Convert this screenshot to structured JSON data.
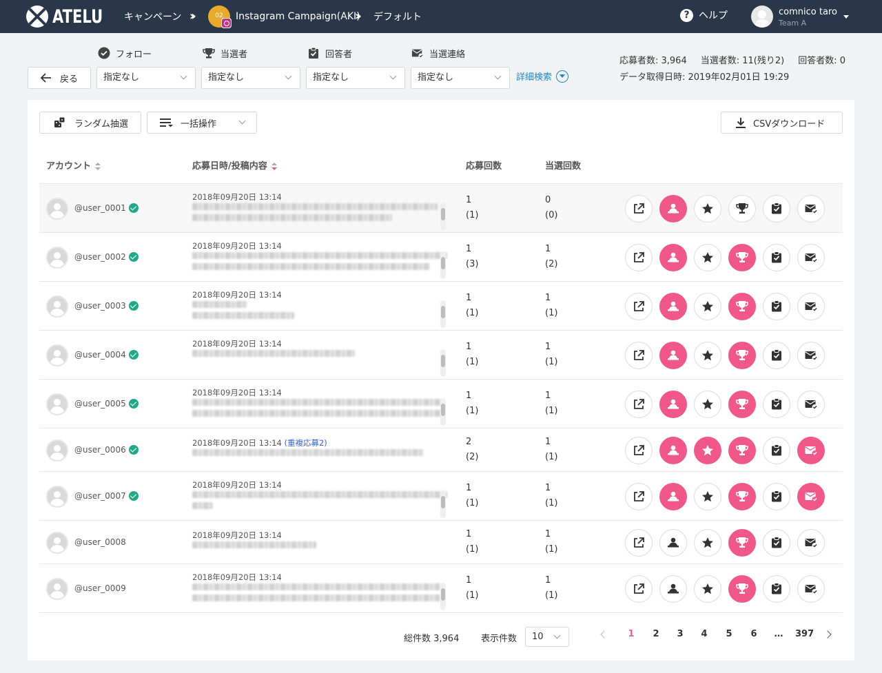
{
  "header": {
    "logo_text": "ATELU",
    "breadcrumb_campaigns": "キャンペーン",
    "campaign_badge": "02",
    "campaign_name": "Instagram Campaign(AKI)",
    "breadcrumb_default": "デフォルト",
    "help_label": "ヘルプ",
    "user_name": "comnico taro",
    "user_team": "Team A"
  },
  "toolbar": {
    "back_label": "戻る",
    "filters": [
      {
        "label": "フォロー",
        "value": "指定なし",
        "icon": "check-circle-icon"
      },
      {
        "label": "当選者",
        "value": "指定なし",
        "icon": "trophy-icon"
      },
      {
        "label": "回答者",
        "value": "指定なし",
        "icon": "clipboard-check-icon"
      },
      {
        "label": "当選連絡",
        "value": "指定なし",
        "icon": "mail-check-icon"
      }
    ],
    "advanced_search": "詳細検索"
  },
  "stats": {
    "applicants": "応募者数: 3,964",
    "winners": "当選者数: 11(残り2)",
    "respondents": "回答者数: 0",
    "fetched_at": "データ取得日時: 2019年02月01日 19:29"
  },
  "actions": {
    "random_draw": "ランダム抽選",
    "bulk_ops": "一括操作",
    "csv_download": "CSVダウンロード"
  },
  "table": {
    "headers": {
      "account": "アカウント",
      "post": "応募日時/投稿内容",
      "apply_count": "応募回数",
      "win_count": "当選回数"
    },
    "rows": [
      {
        "user": "@user_0001",
        "verified": true,
        "date": "2018年09月20日 13:14",
        "dup": "",
        "apply": "1",
        "apply_total": "(1)",
        "win": "0",
        "win_total": "(0)",
        "state": {
          "entry": true,
          "star": false,
          "winner": false,
          "answer": false,
          "notified": false
        }
      },
      {
        "user": "@user_0002",
        "verified": true,
        "date": "2018年09月20日 13:14",
        "dup": "",
        "apply": "1",
        "apply_total": "(3)",
        "win": "1",
        "win_total": "(2)",
        "state": {
          "entry": true,
          "star": false,
          "winner": true,
          "answer": false,
          "notified": false
        }
      },
      {
        "user": "@user_0003",
        "verified": true,
        "date": "2018年09月20日 13:14",
        "dup": "",
        "apply": "1",
        "apply_total": "(1)",
        "win": "1",
        "win_total": "(1)",
        "state": {
          "entry": true,
          "star": false,
          "winner": true,
          "answer": false,
          "notified": false
        }
      },
      {
        "user": "@user_0004",
        "verified": true,
        "date": "2018年09月20日 13:14",
        "dup": "",
        "apply": "1",
        "apply_total": "(1)",
        "win": "1",
        "win_total": "(1)",
        "state": {
          "entry": true,
          "star": false,
          "winner": true,
          "answer": false,
          "notified": false
        }
      },
      {
        "user": "@user_0005",
        "verified": true,
        "date": "2018年09月20日 13:14",
        "dup": "",
        "apply": "1",
        "apply_total": "(1)",
        "win": "1",
        "win_total": "(1)",
        "state": {
          "entry": true,
          "star": false,
          "winner": true,
          "answer": false,
          "notified": false
        }
      },
      {
        "user": "@user_0006",
        "verified": true,
        "date": "2018年09月20日 13:14",
        "dup": "(重複応募2)",
        "apply": "2",
        "apply_total": "(2)",
        "win": "1",
        "win_total": "(1)",
        "state": {
          "entry": true,
          "star": true,
          "winner": true,
          "answer": false,
          "notified": true
        }
      },
      {
        "user": "@user_0007",
        "verified": true,
        "date": "2018年09月20日 13:14",
        "dup": "",
        "apply": "1",
        "apply_total": "(1)",
        "win": "1",
        "win_total": "(1)",
        "state": {
          "entry": true,
          "star": false,
          "winner": true,
          "answer": false,
          "notified": true
        }
      },
      {
        "user": "@user_0008",
        "verified": false,
        "date": "2018年09月20日 13:14",
        "dup": "",
        "apply": "1",
        "apply_total": "(1)",
        "win": "1",
        "win_total": "(1)",
        "state": {
          "entry": false,
          "star": false,
          "winner": true,
          "answer": false,
          "notified": false
        }
      },
      {
        "user": "@user_0009",
        "verified": false,
        "date": "2018年09月20日 13:14",
        "dup": "",
        "apply": "1",
        "apply_total": "(1)",
        "win": "1",
        "win_total": "(1)",
        "state": {
          "entry": false,
          "star": false,
          "winner": true,
          "answer": false,
          "notified": false
        }
      }
    ]
  },
  "pagination": {
    "total": "総件数 3,964",
    "per_page_label": "表示件数",
    "per_page": "10",
    "pages": [
      "1",
      "2",
      "3",
      "4",
      "5",
      "6",
      "…",
      "397"
    ],
    "current": "1"
  },
  "colors": {
    "accent": "#f0588a",
    "topbar": "#2a3748",
    "link": "#1e88c8",
    "verified": "#22a889"
  }
}
